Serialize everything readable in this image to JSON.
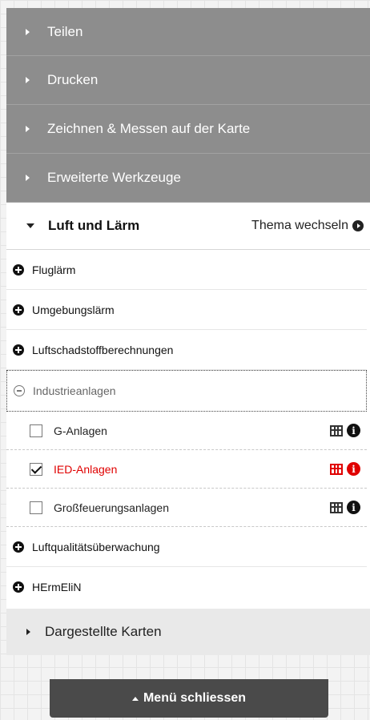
{
  "tools": [
    {
      "label": "Teilen"
    },
    {
      "label": "Drucken"
    },
    {
      "label": "Zeichnen & Messen auf der Karte"
    },
    {
      "label": "Erweiterte Werkzeuge"
    }
  ],
  "theme": {
    "title": "Luft und Lärm",
    "switch_label": "Thema wechseln"
  },
  "groups": [
    {
      "label": "Fluglärm"
    },
    {
      "label": "Umgebungslärm"
    },
    {
      "label": "Luftschadstoffberechnungen"
    }
  ],
  "open_group": {
    "label": "Industrieanlagen",
    "layers": [
      {
        "label": "G-Anlagen",
        "checked": false
      },
      {
        "label": "IED-Anlagen",
        "checked": true
      },
      {
        "label": "Großfeuerungsanlagen",
        "checked": false
      }
    ]
  },
  "groups_after": [
    {
      "label": "Luftqualitätsüberwachung"
    },
    {
      "label": "HErmEliN"
    }
  ],
  "maps_section": {
    "label": "Dargestellte Karten"
  },
  "close_button": {
    "label": "Menü schliessen"
  },
  "colors": {
    "active": "#e00000",
    "tool_bg": "#8d8d8d",
    "close_bg": "#4a4a4a"
  }
}
